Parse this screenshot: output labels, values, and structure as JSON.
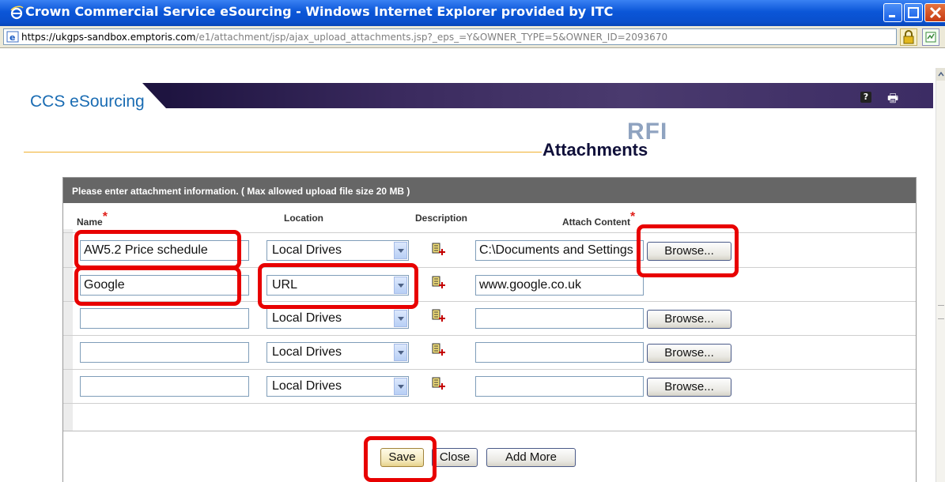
{
  "window": {
    "title": "Crown Commercial Service eSourcing - Windows Internet Explorer provided by ITC",
    "url_prefix": "https://ukgps-sandbox.",
    "url_domain": "emptoris.com",
    "url_rest": "/e1/attachment/jsp/ajax_upload_attachments.jsp?_eps_=Y&OWNER_TYPE=5&OWNER_ID=2093670"
  },
  "app": {
    "logo": "CCS eSourcing",
    "help_label": "?",
    "print_label": "🖶"
  },
  "page": {
    "rfi": "RFI",
    "title": "Attachments"
  },
  "form": {
    "instructions": "Please enter attachment information. ( Max allowed upload file size 20 MB )",
    "columns": {
      "name": "Name",
      "location": "Location",
      "description": "Description",
      "attach_content": "Attach Content"
    },
    "required_mark": "*",
    "rows": [
      {
        "name": "AW5.2 Price schedule",
        "location": "Local Drives",
        "content": "C:\\Documents and Settings",
        "browse": "Browse..."
      },
      {
        "name": "Google",
        "location": "URL",
        "content": "www.google.co.uk",
        "browse": ""
      },
      {
        "name": "",
        "location": "Local Drives",
        "content": "",
        "browse": "Browse..."
      },
      {
        "name": "",
        "location": "Local Drives",
        "content": "",
        "browse": "Browse..."
      },
      {
        "name": "",
        "location": "Local Drives",
        "content": "",
        "browse": "Browse..."
      }
    ],
    "buttons": {
      "save": "Save",
      "close": "Close",
      "add_more": "Add More"
    }
  },
  "colors": {
    "highlight": "#e80000",
    "header_bg": "#666666",
    "accent_line": "#f0b030",
    "logo": "#1a6cb3"
  }
}
